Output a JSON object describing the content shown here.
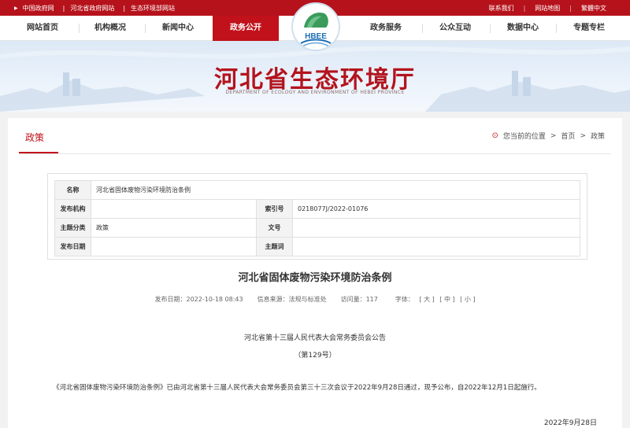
{
  "topbar": {
    "links_left": [
      "中国政府网",
      "河北省政府网站",
      "生态环境部网站"
    ],
    "links_right": [
      "联系我们",
      "网站地图",
      "繁體中文"
    ]
  },
  "nav": {
    "items": [
      "网站首页",
      "机构概况",
      "新闻中心",
      "政务公开",
      "政务服务",
      "公众互动",
      "数据中心",
      "专题专栏"
    ],
    "active": "政务公开"
  },
  "logo": {
    "text": "HBEE"
  },
  "banner": {
    "title": "河北省生态环境厅",
    "subtitle": "DEPARTMENT OF ECOLOGY AND ENVIRONMENT OF HEBEI PROVINCE"
  },
  "page": {
    "title": "政策",
    "breadcrumb": {
      "prefix": "您当前的位置",
      "items": [
        "首页",
        "政策"
      ],
      "separator": ">"
    }
  },
  "info": {
    "rows": [
      {
        "k1": "名称",
        "v1": "河北省固体废物污染环境防治条例",
        "k2": "",
        "v2": ""
      },
      {
        "k1": "发布机构",
        "v1": "",
        "k2": "索引号",
        "v2": "0218077J/2022-01076"
      },
      {
        "k1": "主题分类",
        "v1": "政策",
        "k2": "文号",
        "v2": ""
      },
      {
        "k1": "发布日期",
        "v1": "",
        "k2": "主题词",
        "v2": ""
      }
    ]
  },
  "doc": {
    "title": "河北省固体废物污染环境防治条例",
    "meta": {
      "date_label": "发布日期：",
      "date": "2022-10-18 08:43",
      "source_label": "信息来源：",
      "source": "法规与标准处",
      "views_label": "访问量：",
      "views": "117",
      "size_label": "字体：",
      "size_large": "[ 大 ]",
      "size_medium": "[ 中 ]",
      "size_small": "[ 小 ]"
    },
    "announce_title": "河北省第十三届人民代表大会常务委员会公告",
    "announce_no": "（第129号）",
    "paragraph": "《河北省固体废物污染环境防治条例》已由河北省第十三届人民代表大会常务委员会第三十三次会议于2022年9月28日通过，现予公布，自2022年12月1日起施行。",
    "date_sign": "2022年9月28日"
  },
  "colors": {
    "primary_red": "#c1121c",
    "banner_blue": "#dce8f5"
  }
}
